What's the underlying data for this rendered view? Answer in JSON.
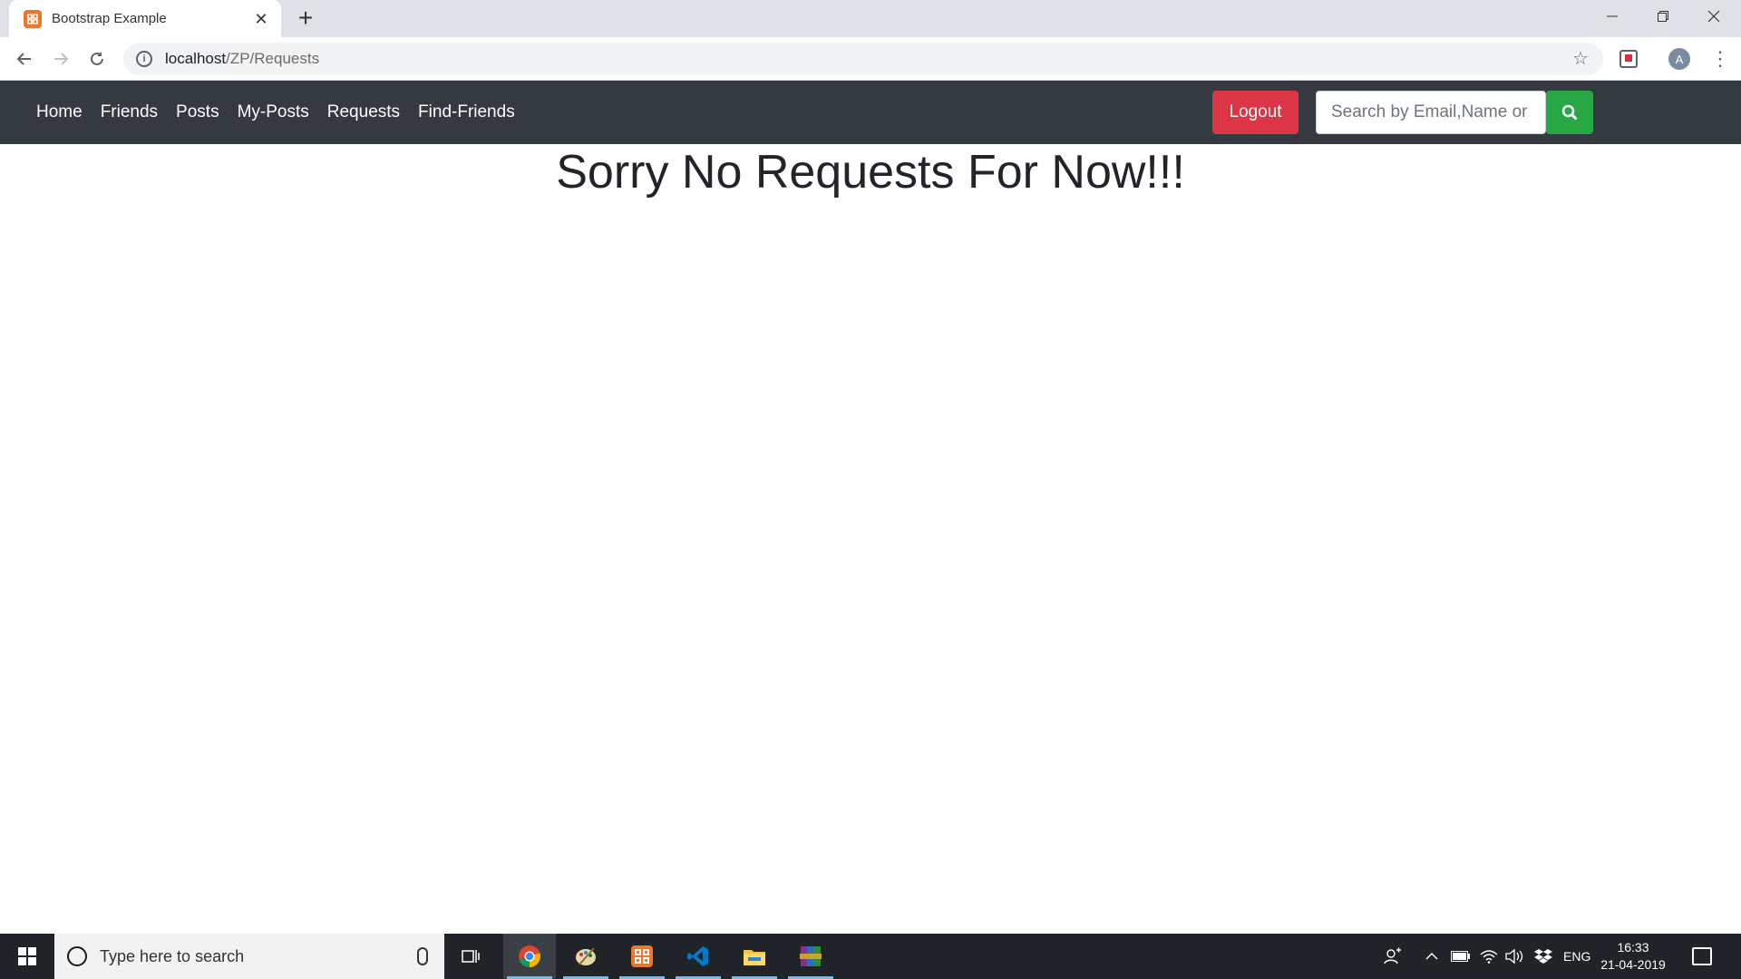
{
  "browser": {
    "tab_title": "Bootstrap Example",
    "url_host": "localhost",
    "url_path": "/ZP/Requests",
    "avatar_letter": "A"
  },
  "navbar": {
    "links": [
      "Home",
      "Friends",
      "Posts",
      "My-Posts",
      "Requests",
      "Find-Friends"
    ],
    "logout_label": "Logout",
    "search_placeholder": "Search by Email,Name or",
    "colors": {
      "bg": "#343a40",
      "logout": "#dc3545",
      "search_btn": "#28a745"
    }
  },
  "main": {
    "heading": "Sorry No Requests For Now!!!"
  },
  "taskbar": {
    "search_placeholder": "Type here to search",
    "language": "ENG",
    "time": "16:33",
    "date": "21-04-2019"
  }
}
